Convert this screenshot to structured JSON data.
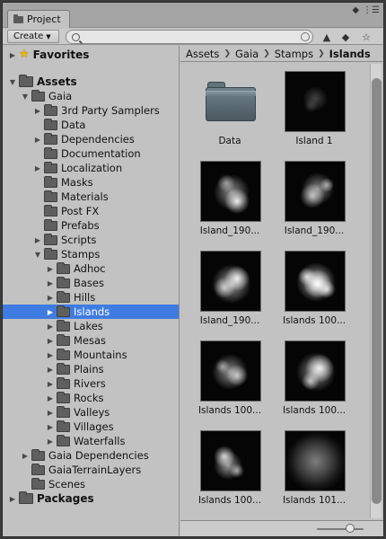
{
  "tab": {
    "label": "Project"
  },
  "toolbar": {
    "create_label": "Create",
    "search": {
      "value": "",
      "placeholder": ""
    }
  },
  "tree": {
    "rows": [
      {
        "label": "Favorites",
        "depth": 0,
        "expanded": false,
        "icon": "star",
        "bold": true
      },
      {
        "label": "Assets",
        "depth": 0,
        "expanded": true,
        "icon": "folder",
        "bold": true
      },
      {
        "label": "Gaia",
        "depth": 1,
        "expanded": true,
        "icon": "folder"
      },
      {
        "label": "3rd Party Samplers",
        "depth": 2,
        "expanded": false,
        "icon": "folder"
      },
      {
        "label": "Data",
        "depth": 2,
        "expanded": null,
        "icon": "folder"
      },
      {
        "label": "Dependencies",
        "depth": 2,
        "expanded": false,
        "icon": "folder"
      },
      {
        "label": "Documentation",
        "depth": 2,
        "expanded": null,
        "icon": "folder"
      },
      {
        "label": "Localization",
        "depth": 2,
        "expanded": false,
        "icon": "folder"
      },
      {
        "label": "Masks",
        "depth": 2,
        "expanded": null,
        "icon": "folder"
      },
      {
        "label": "Materials",
        "depth": 2,
        "expanded": null,
        "icon": "folder"
      },
      {
        "label": "Post FX",
        "depth": 2,
        "expanded": null,
        "icon": "folder"
      },
      {
        "label": "Prefabs",
        "depth": 2,
        "expanded": null,
        "icon": "folder"
      },
      {
        "label": "Scripts",
        "depth": 2,
        "expanded": false,
        "icon": "folder"
      },
      {
        "label": "Stamps",
        "depth": 2,
        "expanded": true,
        "icon": "folder"
      },
      {
        "label": "Adhoc",
        "depth": 3,
        "expanded": false,
        "icon": "folder"
      },
      {
        "label": "Bases",
        "depth": 3,
        "expanded": false,
        "icon": "folder"
      },
      {
        "label": "Hills",
        "depth": 3,
        "expanded": false,
        "icon": "folder"
      },
      {
        "label": "Islands",
        "depth": 3,
        "expanded": false,
        "icon": "folder",
        "selected": true
      },
      {
        "label": "Lakes",
        "depth": 3,
        "expanded": false,
        "icon": "folder"
      },
      {
        "label": "Mesas",
        "depth": 3,
        "expanded": false,
        "icon": "folder"
      },
      {
        "label": "Mountains",
        "depth": 3,
        "expanded": false,
        "icon": "folder"
      },
      {
        "label": "Plains",
        "depth": 3,
        "expanded": false,
        "icon": "folder"
      },
      {
        "label": "Rivers",
        "depth": 3,
        "expanded": false,
        "icon": "folder"
      },
      {
        "label": "Rocks",
        "depth": 3,
        "expanded": false,
        "icon": "folder"
      },
      {
        "label": "Valleys",
        "depth": 3,
        "expanded": false,
        "icon": "folder"
      },
      {
        "label": "Villages",
        "depth": 3,
        "expanded": false,
        "icon": "folder"
      },
      {
        "label": "Waterfalls",
        "depth": 3,
        "expanded": false,
        "icon": "folder"
      },
      {
        "label": "Gaia Dependencies",
        "depth": 1,
        "expanded": false,
        "icon": "folder"
      },
      {
        "label": "GaiaTerrainLayers",
        "depth": 1,
        "expanded": null,
        "icon": "folder"
      },
      {
        "label": "Scenes",
        "depth": 1,
        "expanded": null,
        "icon": "folder"
      },
      {
        "label": "Packages",
        "depth": 0,
        "expanded": false,
        "icon": "folder",
        "bold": true
      }
    ]
  },
  "breadcrumb": [
    "Assets",
    "Gaia",
    "Stamps",
    "Islands"
  ],
  "assets": [
    {
      "label": "Data",
      "kind": "folder"
    },
    {
      "label": "Island 1",
      "kind": "texture"
    },
    {
      "label": "Island_190...",
      "kind": "texture"
    },
    {
      "label": "Island_190...",
      "kind": "texture"
    },
    {
      "label": "Island_190...",
      "kind": "texture"
    },
    {
      "label": "Islands 100...",
      "kind": "texture"
    },
    {
      "label": "Islands 100...",
      "kind": "texture"
    },
    {
      "label": "Islands 100...",
      "kind": "texture"
    },
    {
      "label": "Islands 100...",
      "kind": "texture"
    },
    {
      "label": "Islands 101...",
      "kind": "texture"
    }
  ],
  "colors": {
    "selection": "#3e7ce1",
    "panel": "#c2c2c2"
  },
  "icons": {
    "window": [
      "lock-icon",
      "menu-icon"
    ],
    "toolbar": [
      "filter-by-type-icon",
      "filter-by-label-icon",
      "favorite-star-icon"
    ]
  }
}
